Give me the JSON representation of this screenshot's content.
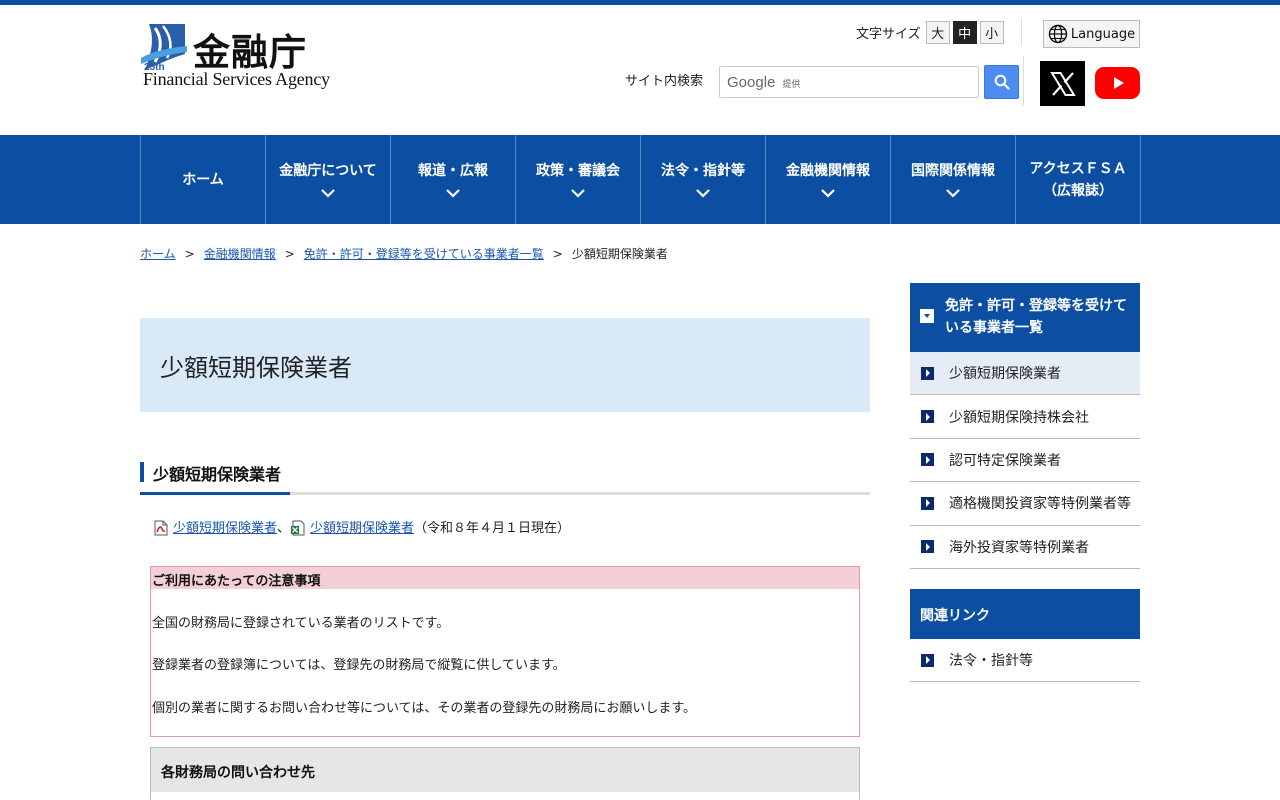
{
  "header": {
    "logo_kanji": "金融庁",
    "logo_en": "Financial Services Agency",
    "logo_badge": "25th",
    "font_size_label": "文字サイズ",
    "font_sizes": [
      "大",
      "中",
      "小"
    ],
    "font_size_selected": "中",
    "language_label": "Language",
    "search_label": "サイト内検索",
    "search_brand": "Google",
    "search_provided": "提供"
  },
  "nav": {
    "items": [
      {
        "label": "ホーム"
      },
      {
        "label": "金融庁について"
      },
      {
        "label": "報道・広報"
      },
      {
        "label": "政策・審議会"
      },
      {
        "label": "法令・指針等"
      },
      {
        "label": "金融機関情報"
      },
      {
        "label": "国際関係情報"
      },
      {
        "label_line1": "アクセスＦＳＡ",
        "label_line2": "（広報誌）"
      }
    ]
  },
  "breadcrumb": {
    "items": [
      "ホーム",
      "金融機関情報",
      "免許・許可・登録等を受けている事業者一覧"
    ],
    "current": "少額短期保険業者",
    "separator": ">"
  },
  "main": {
    "page_title": "少額短期保険業者",
    "section_heading": "少額短期保険業者",
    "file_pdf_label": "少額短期保険業者",
    "file_comma": "、",
    "file_xls_label": "少額短期保険業者",
    "file_date": "（令和８年４月１日現在）",
    "notice": {
      "heading": "ご利用にあたっての注意事項",
      "p1": "全国の財務局に登録されている業者のリストです。",
      "p2": "登録業者の登録簿については、登録先の財務局で縦覧に供しています。",
      "p3": "個別の業者に関するお問い合わせ等については、その業者の登録先の財務局にお願いします。"
    },
    "contact_heading": "各財務局の問い合わせ先"
  },
  "sidebar": {
    "heading": "免許・許可・登録等を受けている事業者一覧",
    "items": [
      {
        "label": "少額短期保険業者"
      },
      {
        "label": "少額短期保険持株会社"
      },
      {
        "label": "認可特定保険業者"
      },
      {
        "label": "適格機関投資家等特例業者等"
      },
      {
        "label": "海外投資家等特例業者"
      }
    ],
    "related_heading": "関連リンク",
    "related_items": [
      {
        "label": "法令・指針等"
      }
    ]
  },
  "colors": {
    "brand_blue": "#0b4ea2",
    "title_bg": "#d9e9f8",
    "notice_border": "#e39aa5",
    "notice_head_bg": "#f3d0d5",
    "youtube_red": "#ff0000"
  }
}
